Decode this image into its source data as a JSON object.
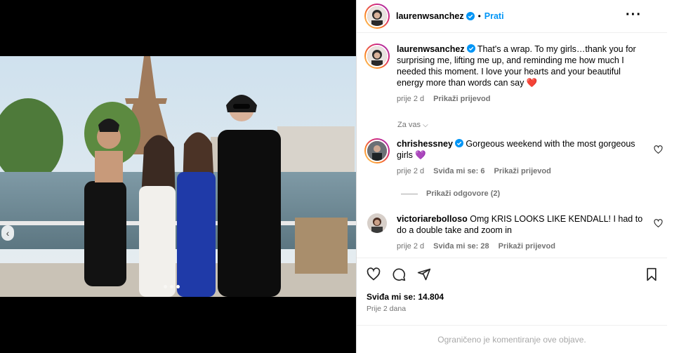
{
  "post": {
    "author": "laurenwsanchez",
    "separator": "•",
    "follow_label": "Prati",
    "more_icon": "more-horizontal-icon",
    "carousel": {
      "total": 3,
      "active": 2
    }
  },
  "caption": {
    "username": "laurenwsanchez",
    "text": "That's a wrap. To my girls…thank you for surprising me, lifting me up, and reminding me how much I needed this moment. I love your hearts and your beautiful energy more than words can say ❤️",
    "time": "prije 2 d",
    "translate": "Prikaži prijevod"
  },
  "for_you_label": "Za vas",
  "comments": [
    {
      "username": "chrishessney",
      "text": "Gorgeous weekend with the most gorgeous girls 💜",
      "time": "prije 2 d",
      "likes": "Sviđa mi se: 6",
      "translate": "Prikaži prijevod",
      "show_replies": "Prikaži odgovore (2)"
    },
    {
      "username": "victoriarebolloso",
      "text": "Omg KRIS LOOKS LIKE KENDALL! I had to do a double take and zoom in",
      "time": "prije 2 d",
      "likes": "Sviđa mi se: 28",
      "translate": "Prikaži prijevod"
    }
  ],
  "stats": {
    "likes": "Sviđa mi se: 14.804",
    "date": "Prije 2 dana"
  },
  "footer_text": "Ograničeno je komentiranje ove objave.",
  "colors": {
    "accent": "#0095f6",
    "heart": "#ff3040",
    "verified": "#0095f6"
  }
}
